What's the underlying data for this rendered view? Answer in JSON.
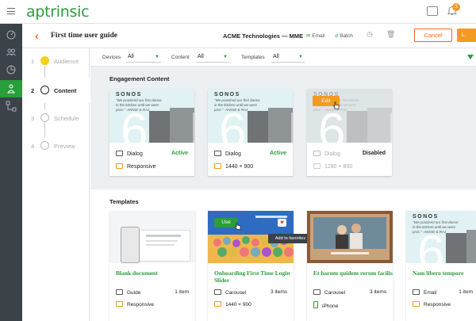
{
  "app": {
    "logo": "aptrinsic",
    "notifications": "3"
  },
  "header": {
    "title": "First time user guide",
    "org": "ACME Technologies — MME",
    "email": "Email",
    "batch": "Batch",
    "cancel": "Cancel",
    "launch": "L"
  },
  "steps": [
    {
      "num": "1",
      "label": "Audience"
    },
    {
      "num": "2",
      "label": "Content"
    },
    {
      "num": "3",
      "label": "Schedule"
    },
    {
      "num": "4",
      "label": "Preview"
    }
  ],
  "filters": {
    "devices_label": "Devices",
    "devices_value": "All",
    "content_label": "Content",
    "content_value": "All",
    "templates_label": "Templates",
    "templates_value": "All"
  },
  "engagement": {
    "heading": "Engagement Content",
    "edit_label": "Edit",
    "cards": [
      {
        "type": "Dialog",
        "status": "Active",
        "meta": "Responsive"
      },
      {
        "type": "Dialog",
        "status": "Active",
        "meta": "1440 × 900"
      },
      {
        "type": "Dialog",
        "status": "Disabled",
        "meta": "1280 × 800"
      }
    ],
    "thumb": {
      "brand": "SONOS",
      "quote": "“We practiced our first dance in the kitchen until we were pros.” -ANGIE & RAJ",
      "big": "6"
    }
  },
  "templates": {
    "heading": "Templates",
    "use_label": "Use",
    "favorite_tooltip": "Add to favorites",
    "cards": [
      {
        "title": "Blank document",
        "type": "Guide",
        "count": "1 item",
        "meta": "Responsive"
      },
      {
        "title": "Onboarding First Time Login Slider",
        "type": "Carousel",
        "count": "3 items",
        "meta": "1440 × 900"
      },
      {
        "title": "Et harum quidem rerum facilis",
        "type": "Carousel",
        "count": "3 items",
        "meta": "iPhone"
      },
      {
        "title": "Nam libero tempore",
        "type": "Email",
        "count": "1 item",
        "meta": "Responsive"
      }
    ]
  },
  "colors": {
    "accent": "#2a9d3c",
    "orange": "#f06a1f",
    "sidebar": "#3b4248"
  }
}
